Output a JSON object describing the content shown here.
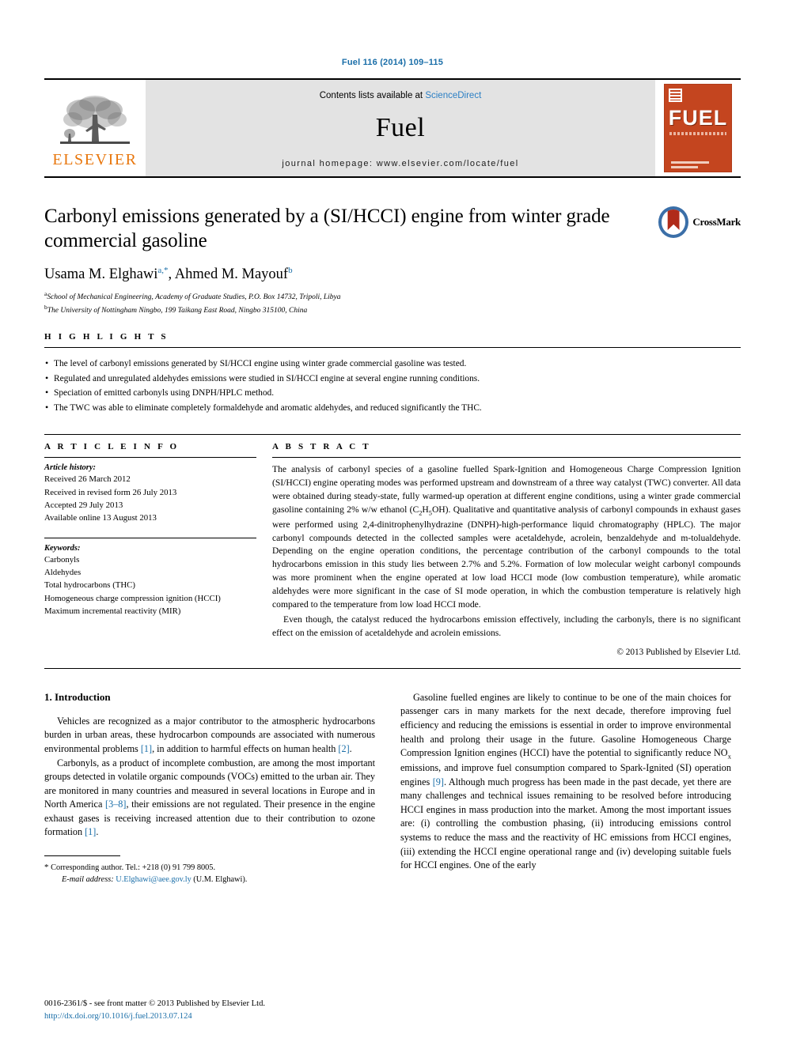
{
  "running_head": "Fuel 116 (2014) 109–115",
  "masthead": {
    "publisher_logo_label": "ELSEVIER",
    "contents_prefix": "Contents lists available at ",
    "contents_link": "ScienceDirect",
    "journal_name": "Fuel",
    "homepage_line": "journal homepage: www.elsevier.com/locate/fuel",
    "cover_title": "FUEL",
    "cover_tagline": "the science and technology of fuel and energy"
  },
  "article": {
    "title": "Carbonyl emissions generated by a (SI/HCCI) engine from winter grade commercial gasoline",
    "authors_plain": "Usama M. Elghawi",
    "author1": "Usama M. Elghawi",
    "author1_marks": "a,*",
    "author2": ", Ahmed M. Mayouf",
    "author2_marks": "b",
    "affiliation_a_mark": "a",
    "affiliation_a": "School of Mechanical Engineering, Academy of Graduate Studies, P.O. Box 14732, Tripoli, Libya",
    "affiliation_b_mark": "b",
    "affiliation_b": "The University of Nottingham Ningbo, 199 Taikang East Road, Ningbo 315100, China",
    "crossmark_label": "CrossMark"
  },
  "highlights": {
    "heading": "H I G H L I G H T S",
    "items": [
      "The level of carbonyl emissions generated by SI/HCCI engine using winter grade commercial gasoline was tested.",
      "Regulated and unregulated aldehydes emissions were studied in SI/HCCI engine at several engine running conditions.",
      "Speciation of emitted carbonyls using DNPH/HPLC method.",
      "The TWC was able to eliminate completely formaldehyde and aromatic aldehydes, and reduced significantly the THC."
    ]
  },
  "article_info": {
    "heading": "A R T I C L E    I N F O",
    "history_label": "Article history:",
    "history": [
      "Received 26 March 2012",
      "Received in revised form 26 July 2013",
      "Accepted 29 July 2013",
      "Available online 13 August 2013"
    ],
    "keywords_label": "Keywords:",
    "keywords": [
      "Carbonyls",
      "Aldehydes",
      "Total hydrocarbons (THC)",
      "Homogeneous charge compression ignition (HCCI)",
      "Maximum incremental reactivity (MIR)"
    ]
  },
  "abstract": {
    "heading": "A B S T R A C T",
    "paragraph1_part1": "The analysis of carbonyl species of a gasoline fuelled Spark-Ignition and Homogeneous Charge Compression Ignition (SI/HCCI) engine operating modes was performed upstream and downstream of a three way catalyst (TWC) converter. All data were obtained during steady-state, fully warmed-up operation at different engine conditions, using a winter grade commercial gasoline containing 2% w/w ethanol (C",
    "formula_sub1": "2",
    "formula_mid": "H",
    "formula_sub2": "5",
    "formula_end": "OH).",
    "paragraph1_part2": " Qualitative and quantitative analysis of carbonyl compounds in exhaust gases were performed using 2,4-dinitrophenylhydrazine (DNPH)-high-performance liquid chromatography (HPLC). The major carbonyl compounds detected in the collected samples were acetaldehyde, acrolein, benzaldehyde and m-tolualdehyde. Depending on the engine operation conditions, the percentage contribution of the carbonyl compounds to the total hydrocarbons emission in this study lies between 2.7% and 5.2%. Formation of low molecular weight carbonyl compounds was more prominent when the engine operated at low load HCCI mode (low combustion temperature), while aromatic aldehydes were more significant in the case of SI mode operation, in which the combustion temperature is relatively high compared to the temperature from low load HCCI mode.",
    "paragraph2": "Even though, the catalyst reduced the hydrocarbons emission effectively, including the carbonyls, there is no significant effect on the emission of acetaldehyde and acrolein emissions.",
    "copyright": "© 2013 Published by Elsevier Ltd."
  },
  "introduction": {
    "heading": "1. Introduction",
    "left_para1_a": "Vehicles are recognized as a major contributor to the atmospheric hydrocarbons burden in urban areas, these hydrocarbon compounds are associated with numerous environmental problems ",
    "left_para1_ref1": "[1]",
    "left_para1_b": ", in addition to harmful effects on human health ",
    "left_para1_ref2": "[2]",
    "left_para1_c": ".",
    "left_para2_a": "Carbonyls, as a product of incomplete combustion, are among the most important groups detected in volatile organic compounds (VOCs) emitted to the urban air. They are monitored in many countries and measured in several locations in Europe and in North America ",
    "left_para2_ref1": "[3–8]",
    "left_para2_b": ", their emissions are not regulated. Their presence in the engine exhaust gases is receiving increased attention due to their contribution to ozone formation ",
    "left_para2_ref2": "[1]",
    "left_para2_c": ".",
    "right_para_a": "Gasoline fuelled engines are likely to continue to be one of the main choices for passenger cars in many markets for the next decade, therefore improving fuel efficiency and reducing the emissions is essential in order to improve environmental health and prolong their usage in the future. Gasoline Homogeneous Charge Compression Ignition engines (HCCI) have the potential to significantly reduce NO",
    "right_para_sub": "x",
    "right_para_b": " emissions, and improve fuel consumption compared to Spark-Ignited (SI) operation engines ",
    "right_para_ref": "[9]",
    "right_para_c": ". Although much progress has been made in the past decade, yet there are many challenges and technical issues remaining to be resolved before introducing HCCI engines in mass production into the market. Among the most important issues are: (i) controlling the combustion phasing, (ii) introducing emissions control systems to reduce the mass and the reactivity of HC emissions from HCCI engines, (iii) extending the HCCI engine operational range and (iv) developing suitable fuels for HCCI engines. One of the early"
  },
  "footnote": {
    "star": "*",
    "corresponding": "Corresponding author. Tel.: +218 (0) 91 799 8005.",
    "email_label": "E-mail address:",
    "email": "U.Elghawi@aee.gov.ly",
    "email_owner": "(U.M. Elghawi)."
  },
  "footer": {
    "issn_line": "0016-2361/$ - see front matter © 2013 Published by Elsevier Ltd.",
    "doi": "http://dx.doi.org/10.1016/j.fuel.2013.07.124"
  },
  "colors": {
    "link": "#1a6ea8",
    "elsevier_orange": "#e8760c",
    "cover_red": "#c4451f",
    "masthead_grey": "#e3e3e3"
  }
}
